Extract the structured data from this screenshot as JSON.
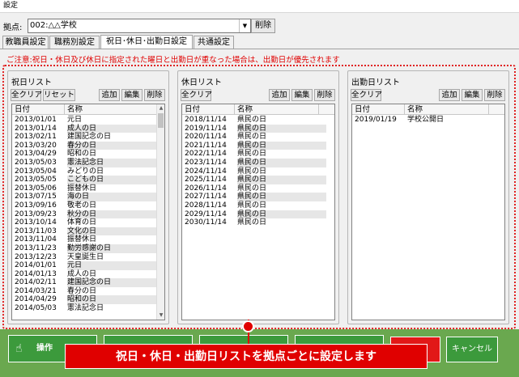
{
  "window": {
    "title": "設定"
  },
  "location": {
    "label": "拠点:",
    "value": "002:△△学校",
    "delete_label": "削除"
  },
  "tabs": [
    {
      "label": "教職員設定"
    },
    {
      "label": "職務別設定"
    },
    {
      "label": "祝日･休日･出勤日設定"
    },
    {
      "label": "共通設定"
    }
  ],
  "notice": "ご注意:祝日・休日及び休日に指定された曜日と出勤日が重なった場合は、出勤日が優先されます",
  "columns": {
    "date": "日付",
    "name": "名称"
  },
  "holidays": {
    "title": "祝日リスト",
    "clear_label": "全クリア",
    "reset_label": "リセット",
    "add_label": "追加",
    "edit_label": "編集",
    "delete_label": "削除",
    "rows": [
      [
        "2013/01/01",
        "元日"
      ],
      [
        "2013/01/14",
        "成人の日"
      ],
      [
        "2013/02/11",
        "建国記念の日"
      ],
      [
        "2013/03/20",
        "春分の日"
      ],
      [
        "2013/04/29",
        "昭和の日"
      ],
      [
        "2013/05/03",
        "憲法記念日"
      ],
      [
        "2013/05/04",
        "みどりの日"
      ],
      [
        "2013/05/05",
        "こどもの日"
      ],
      [
        "2013/05/06",
        "振替休日"
      ],
      [
        "2013/07/15",
        "海の日"
      ],
      [
        "2013/09/16",
        "敬老の日"
      ],
      [
        "2013/09/23",
        "秋分の日"
      ],
      [
        "2013/10/14",
        "体育の日"
      ],
      [
        "2013/11/03",
        "文化の日"
      ],
      [
        "2013/11/04",
        "振替休日"
      ],
      [
        "2013/11/23",
        "勤労感謝の日"
      ],
      [
        "2013/12/23",
        "天皇誕生日"
      ],
      [
        "2014/01/01",
        "元日"
      ],
      [
        "2014/01/13",
        "成人の日"
      ],
      [
        "2014/02/11",
        "建国記念の日"
      ],
      [
        "2014/03/21",
        "春分の日"
      ],
      [
        "2014/04/29",
        "昭和の日"
      ],
      [
        "2014/05/03",
        "憲法記念日"
      ]
    ]
  },
  "rest_days": {
    "title": "休日リスト",
    "clear_label": "全クリア",
    "add_label": "追加",
    "edit_label": "編集",
    "delete_label": "削除",
    "rows": [
      [
        "2018/11/14",
        "県民の日"
      ],
      [
        "2019/11/14",
        "県民の日"
      ],
      [
        "2020/11/14",
        "県民の日"
      ],
      [
        "2021/11/14",
        "県民の日"
      ],
      [
        "2022/11/14",
        "県民の日"
      ],
      [
        "2023/11/14",
        "県民の日"
      ],
      [
        "2024/11/14",
        "県民の日"
      ],
      [
        "2025/11/14",
        "県民の日"
      ],
      [
        "2026/11/14",
        "県民の日"
      ],
      [
        "2027/11/14",
        "県民の日"
      ],
      [
        "2028/11/14",
        "県民の日"
      ],
      [
        "2029/11/14",
        "県民の日"
      ],
      [
        "2030/11/14",
        "県民の日"
      ]
    ]
  },
  "work_days": {
    "title": "出勤日リスト",
    "clear_label": "全クリア",
    "add_label": "追加",
    "edit_label": "編集",
    "delete_label": "削除",
    "rows": [
      [
        "2019/01/19",
        "学校公開日"
      ]
    ]
  },
  "footer": {
    "operation_label": "操作",
    "cancel_label": "キャンセル",
    "caption": "祝日・休日・出勤日リストを拠点ごとに設定します"
  },
  "colors": {
    "accent_red": "#e00000",
    "bottom_green": "#6aa84f",
    "button_green": "#3c9a3c"
  },
  "icons": {
    "operation": "pointing-hand-icon",
    "dropdown": "chevron-down-icon"
  }
}
